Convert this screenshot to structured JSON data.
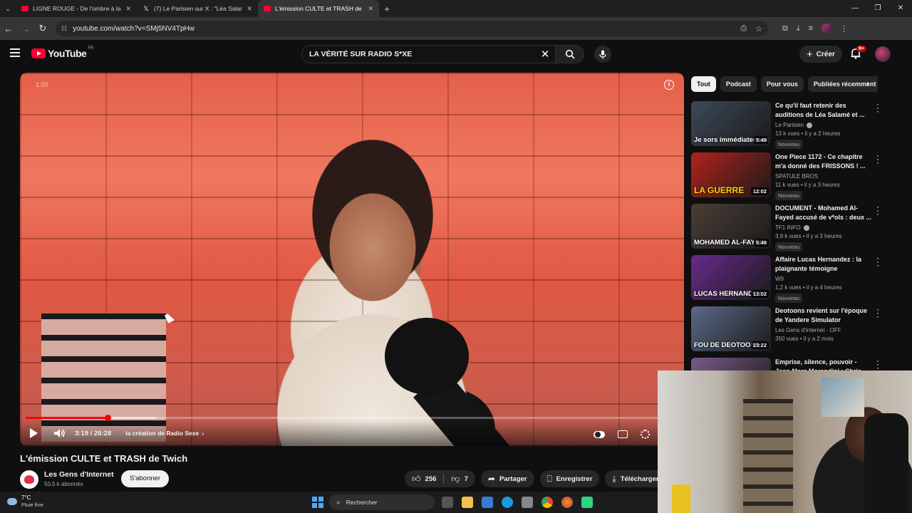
{
  "browser": {
    "tabs": [
      {
        "label": "LIGNE ROUGE - De l'ombre à la",
        "icon": "youtube-icon",
        "active": false
      },
      {
        "label": "(7) Le Parisien sur X : \"Léa Salam",
        "icon": "x-icon",
        "active": false
      },
      {
        "label": "L'émission CULTE et TRASH de",
        "icon": "youtube-icon",
        "active": true
      }
    ],
    "url": "youtube.com/watch?v=SMj5NV4TpHw"
  },
  "header": {
    "logo": "YouTube",
    "logo_country": "FR",
    "search_query": "LA VÉRITÉ SUR RADIO S*XE",
    "create_label": "Créer",
    "notif_count": "9+"
  },
  "player": {
    "top_time": "1:50",
    "time": "3:19 / 26:28",
    "chapter": "la création de Radio Sexe",
    "progress_played": 0.125,
    "progress_loaded": 0.2
  },
  "video": {
    "title": "L'émission CULTE et TRASH de Twich",
    "channel": "Les Gens d'Internet",
    "subscribers": "50,5 k abonnés",
    "subscribe_label": "S'abonner",
    "likes": "256",
    "dislikes": "7",
    "share_label": "Partager",
    "save_label": "Enregistrer",
    "download_label": "Télécharger"
  },
  "chips": [
    "Tout",
    "Podcast",
    "Pour vous",
    "Publiées récemment"
  ],
  "related": [
    {
      "title": "Ce qu'il faut retenir des auditions de Léa Salamé et ...",
      "channel": "Le Parisien",
      "verified": true,
      "meta": "13 k vues • il y a 2 heures",
      "badge": "Nouveau",
      "duration": "5:49",
      "caption": "Je sors immédiatement",
      "bg": "#3d4a5a"
    },
    {
      "title": "One Piece 1172 - Ce chapitre m'a donné des FRISSONS ! ...",
      "channel": "SPATULE BROS",
      "verified": false,
      "meta": "11 k vues • il y a 3 heures",
      "badge": "Nouveau",
      "duration": "12:02",
      "caption": "LA GUERRE",
      "bg": "#b3221d"
    },
    {
      "title": "DOCUMENT - Mohamed Al-Fayed accusé de v*ols : deux ...",
      "channel": "TF1 INFO",
      "verified": true,
      "meta": "3,9 k vues • il y a 3 heures",
      "badge": "Nouveau",
      "duration": "5:48",
      "caption": "MOHAMED AL-FAYED",
      "bg": "#4a3e36"
    },
    {
      "title": "Affaire Lucas Hernandez : la plaignante témoigne",
      "channel": "W9",
      "verified": false,
      "meta": "1,2 k vues • il y a 4 heures",
      "badge": "Nouveau",
      "duration": "13:02",
      "caption": "LUCAS HERNANDEZ",
      "bg": "#6a2a8a"
    },
    {
      "title": "Deotoons revient sur l'époque de Yandere Simulator",
      "channel": "Les Gens d'Internet - OFF",
      "verified": false,
      "meta": "350 vues • il y a 2 mois",
      "badge": "",
      "duration": "23:22",
      "caption": "FOU DE DEOTOONS",
      "bg": "#5c6a88"
    },
    {
      "title": "Emprise, silence, pouvoir - Jean-Marc Morandini : Chris...",
      "channel": "",
      "verified": false,
      "meta": "",
      "badge": "",
      "duration": "",
      "caption": "",
      "bg": "#7a5a88"
    }
  ],
  "taskbar": {
    "temperature": "7°C",
    "weather": "Pluie fine",
    "search_label": "Rechercher"
  },
  "colors": {
    "accent_red": "#ff0033",
    "background": "#0f0f0f",
    "pill": "#272727"
  }
}
